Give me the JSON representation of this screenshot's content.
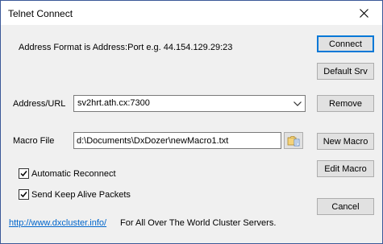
{
  "window": {
    "title": "Telnet Connect",
    "close_icon": "close-icon"
  },
  "info": {
    "address_format": "Address Format is Address:Port e.g. 44.154.129.29:23"
  },
  "address": {
    "label": "Address/URL",
    "value": "sv2hrt.ath.cx:7300"
  },
  "macro": {
    "label": "Macro File",
    "value": "d:\\Documents\\DxDozer\\newMacro1.txt",
    "browse_icon": "folder-open-icon"
  },
  "options": {
    "auto_reconnect": {
      "label": "Automatic Reconnect",
      "checked": true
    },
    "keep_alive": {
      "label": "Send Keep Alive Packets",
      "checked": true
    }
  },
  "buttons": {
    "connect": "Connect",
    "default_srv": "Default Srv",
    "remove": "Remove",
    "new_macro": "New Macro",
    "edit_macro": "Edit Macro",
    "cancel": "Cancel"
  },
  "footer": {
    "link": "http://www.dxcluster.info/",
    "text": "For All Over The World Cluster Servers."
  },
  "colors": {
    "accent": "#0078d7",
    "link": "#0066cc"
  }
}
